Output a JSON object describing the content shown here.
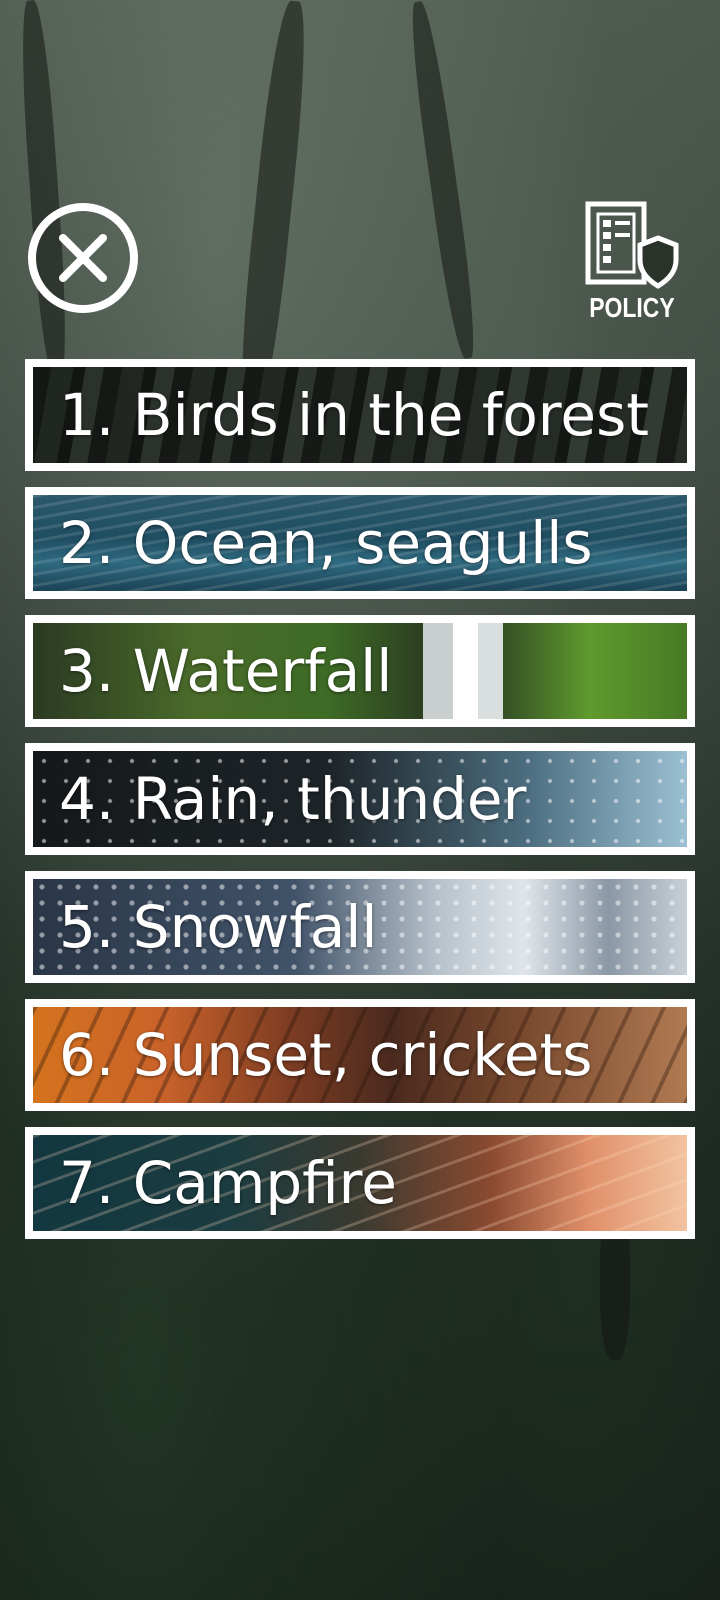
{
  "header": {
    "close_icon": "close-icon",
    "policy_icon": "policy-document-shield-icon",
    "policy_label": "POLICY"
  },
  "sounds": [
    {
      "label": "1. Birds in the forest",
      "theme": "forest"
    },
    {
      "label": "2. Ocean, seagulls",
      "theme": "ocean"
    },
    {
      "label": "3. Waterfall",
      "theme": "waterfall"
    },
    {
      "label": "4. Rain, thunder",
      "theme": "rain"
    },
    {
      "label": "5. Snowfall",
      "theme": "snow"
    },
    {
      "label": "6. Sunset, crickets",
      "theme": "sunset"
    },
    {
      "label": "7. Campfire",
      "theme": "campfire"
    }
  ]
}
